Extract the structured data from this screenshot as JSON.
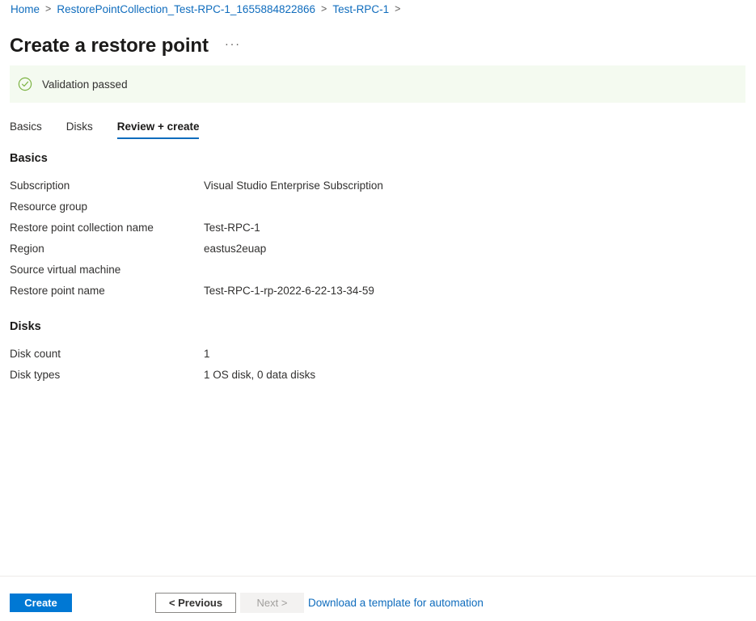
{
  "breadcrumb": {
    "separator": ">",
    "items": [
      {
        "label": "Home"
      },
      {
        "label": "RestorePointCollection_Test-RPC-1_1655884822866"
      },
      {
        "label": "Test-RPC-1"
      }
    ],
    "trailing_separator": ">"
  },
  "header": {
    "title": "Create a restore point",
    "more_menu": "···"
  },
  "validation": {
    "icon": "check-circle-icon",
    "message": "Validation passed",
    "background": "#f4faf0",
    "accent": "#57a300"
  },
  "tabs": [
    {
      "label": "Basics",
      "active": false
    },
    {
      "label": "Disks",
      "active": false
    },
    {
      "label": "Review + create",
      "active": true
    }
  ],
  "sections": [
    {
      "heading": "Basics",
      "rows": [
        {
          "label": "Subscription",
          "value": "Visual Studio Enterprise Subscription"
        },
        {
          "label": "Resource group",
          "value": ""
        },
        {
          "label": "Restore point collection name",
          "value": "Test-RPC-1"
        },
        {
          "label": "Region",
          "value": "eastus2euap"
        },
        {
          "label": "Source virtual machine",
          "value": ""
        },
        {
          "label": "Restore point name",
          "value": "Test-RPC-1-rp-2022-6-22-13-34-59"
        }
      ]
    },
    {
      "heading": "Disks",
      "rows": [
        {
          "label": "Disk count",
          "value": "1"
        },
        {
          "label": "Disk types",
          "value": "1 OS disk, 0 data disks"
        }
      ]
    }
  ],
  "footer": {
    "create_label": "Create",
    "previous_label": "< Previous",
    "next_label": "Next >",
    "next_disabled": true,
    "template_link_label": "Download a template for automation"
  },
  "colors": {
    "accent_blue": "#0078d4",
    "link_blue": "#0f6cbd",
    "success_green": "#57a300",
    "disabled_gray": "#a19f9d"
  }
}
